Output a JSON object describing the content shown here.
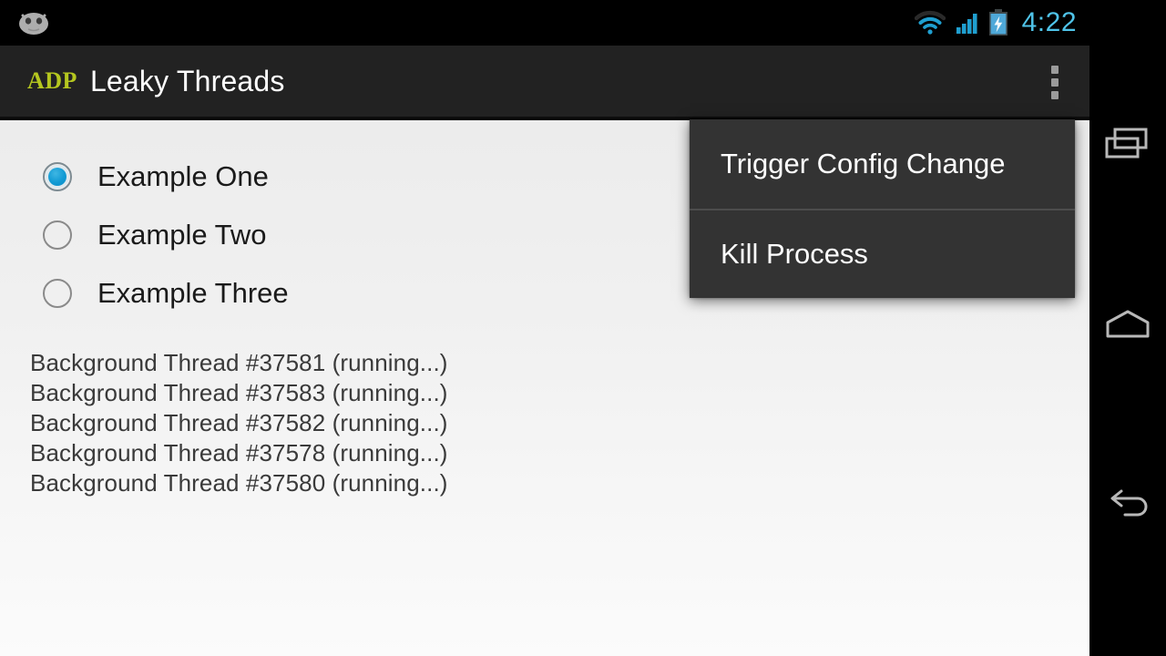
{
  "status_bar": {
    "time": "4:22",
    "icons": [
      "android-mascot-icon",
      "wifi-icon",
      "cellular-signal-icon",
      "battery-charging-icon"
    ],
    "time_color": "#4fc3e8"
  },
  "action_bar": {
    "logo_text": "ADP",
    "logo_color": "#b5c71f",
    "title": "Leaky Threads",
    "overflow_icon": "overflow-menu-icon"
  },
  "content": {
    "radio_options": [
      {
        "label": "Example One",
        "checked": true
      },
      {
        "label": "Example Two",
        "checked": false
      },
      {
        "label": "Example Three",
        "checked": false
      }
    ],
    "radio_accent_color": "#109ad4",
    "threads": [
      "Background Thread #37581 (running...)",
      "Background Thread #37583 (running...)",
      "Background Thread #37582 (running...)",
      "Background Thread #37578 (running...)",
      "Background Thread #37580 (running...)"
    ]
  },
  "popup_menu": {
    "items": [
      {
        "label": "Trigger Config Change"
      },
      {
        "label": "Kill Process"
      }
    ]
  },
  "nav_bar": {
    "buttons": [
      {
        "name": "recents-icon"
      },
      {
        "name": "home-icon"
      },
      {
        "name": "back-icon"
      }
    ]
  }
}
